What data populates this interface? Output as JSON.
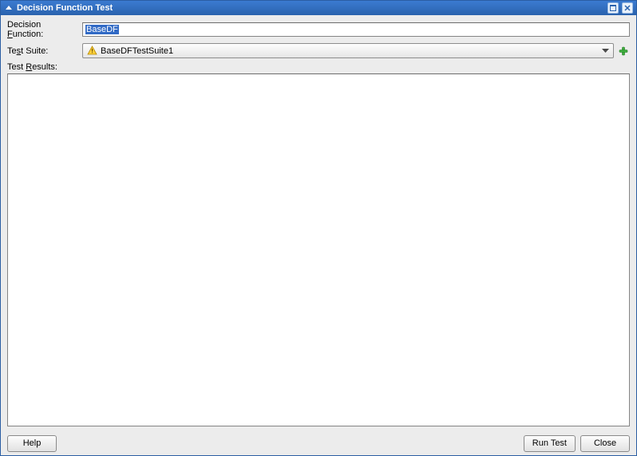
{
  "window": {
    "title": "Decision Function Test"
  },
  "form": {
    "decisionFunction": {
      "label_pre": "Decision ",
      "label_u": "F",
      "label_post": "unction:",
      "value": "BaseDF"
    },
    "testSuite": {
      "label_pre": "Te",
      "label_u": "s",
      "label_post": "t Suite:",
      "selected": "BaseDFTestSuite1"
    },
    "testResults": {
      "label_pre": "Test ",
      "label_u": "R",
      "label_post": "esults:"
    }
  },
  "buttons": {
    "help": "Help",
    "runTest": "Run Test",
    "close": "Close"
  }
}
